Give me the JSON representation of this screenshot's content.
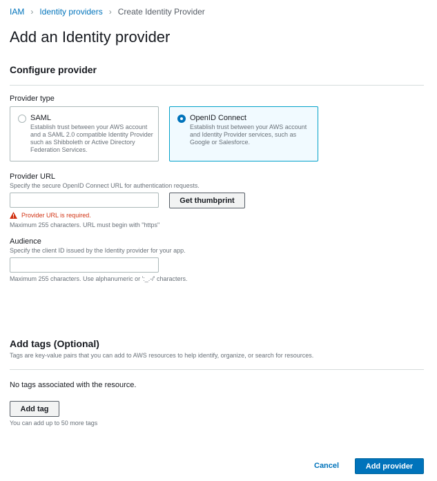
{
  "breadcrumb": {
    "items": [
      "IAM",
      "Identity providers"
    ],
    "current": "Create Identity Provider"
  },
  "page": {
    "title": "Add an Identity provider"
  },
  "configure": {
    "section_title": "Configure provider",
    "provider_type_label": "Provider type",
    "options": [
      {
        "title": "SAML",
        "description": "Establish trust between your AWS account and a SAML 2.0 compatible Identity Provider such as Shibboleth or Active Directory Federation Services.",
        "selected": false
      },
      {
        "title": "OpenID Connect",
        "description": "Establish trust between your AWS account and Identity Provider services, such as Google or Salesforce.",
        "selected": true
      }
    ]
  },
  "provider_url": {
    "label": "Provider URL",
    "description": "Specify the secure OpenID Connect URL for authentication requests.",
    "value": "",
    "button": "Get thumbprint",
    "error": "Provider URL is required.",
    "constraint": "Maximum 255 characters. URL must begin with \"https\""
  },
  "audience": {
    "label": "Audience",
    "description": "Specify the client ID issued by the Identity provider for your app.",
    "value": "",
    "constraint": "Maximum 255 characters. Use alphanumeric or ':_.-/' characters."
  },
  "tags": {
    "section_title": "Add tags (Optional)",
    "description": "Tags are key-value pairs that you can add to AWS resources to help identify, organize, or search for resources.",
    "empty_text": "No tags associated with the resource.",
    "add_button": "Add tag",
    "remaining": "You can add up to 50 more tags"
  },
  "footer": {
    "cancel": "Cancel",
    "submit": "Add provider"
  },
  "colors": {
    "link": "#0073bb",
    "primary": "#0073bb",
    "error": "#d13212",
    "selected_border": "#00a1c9"
  }
}
